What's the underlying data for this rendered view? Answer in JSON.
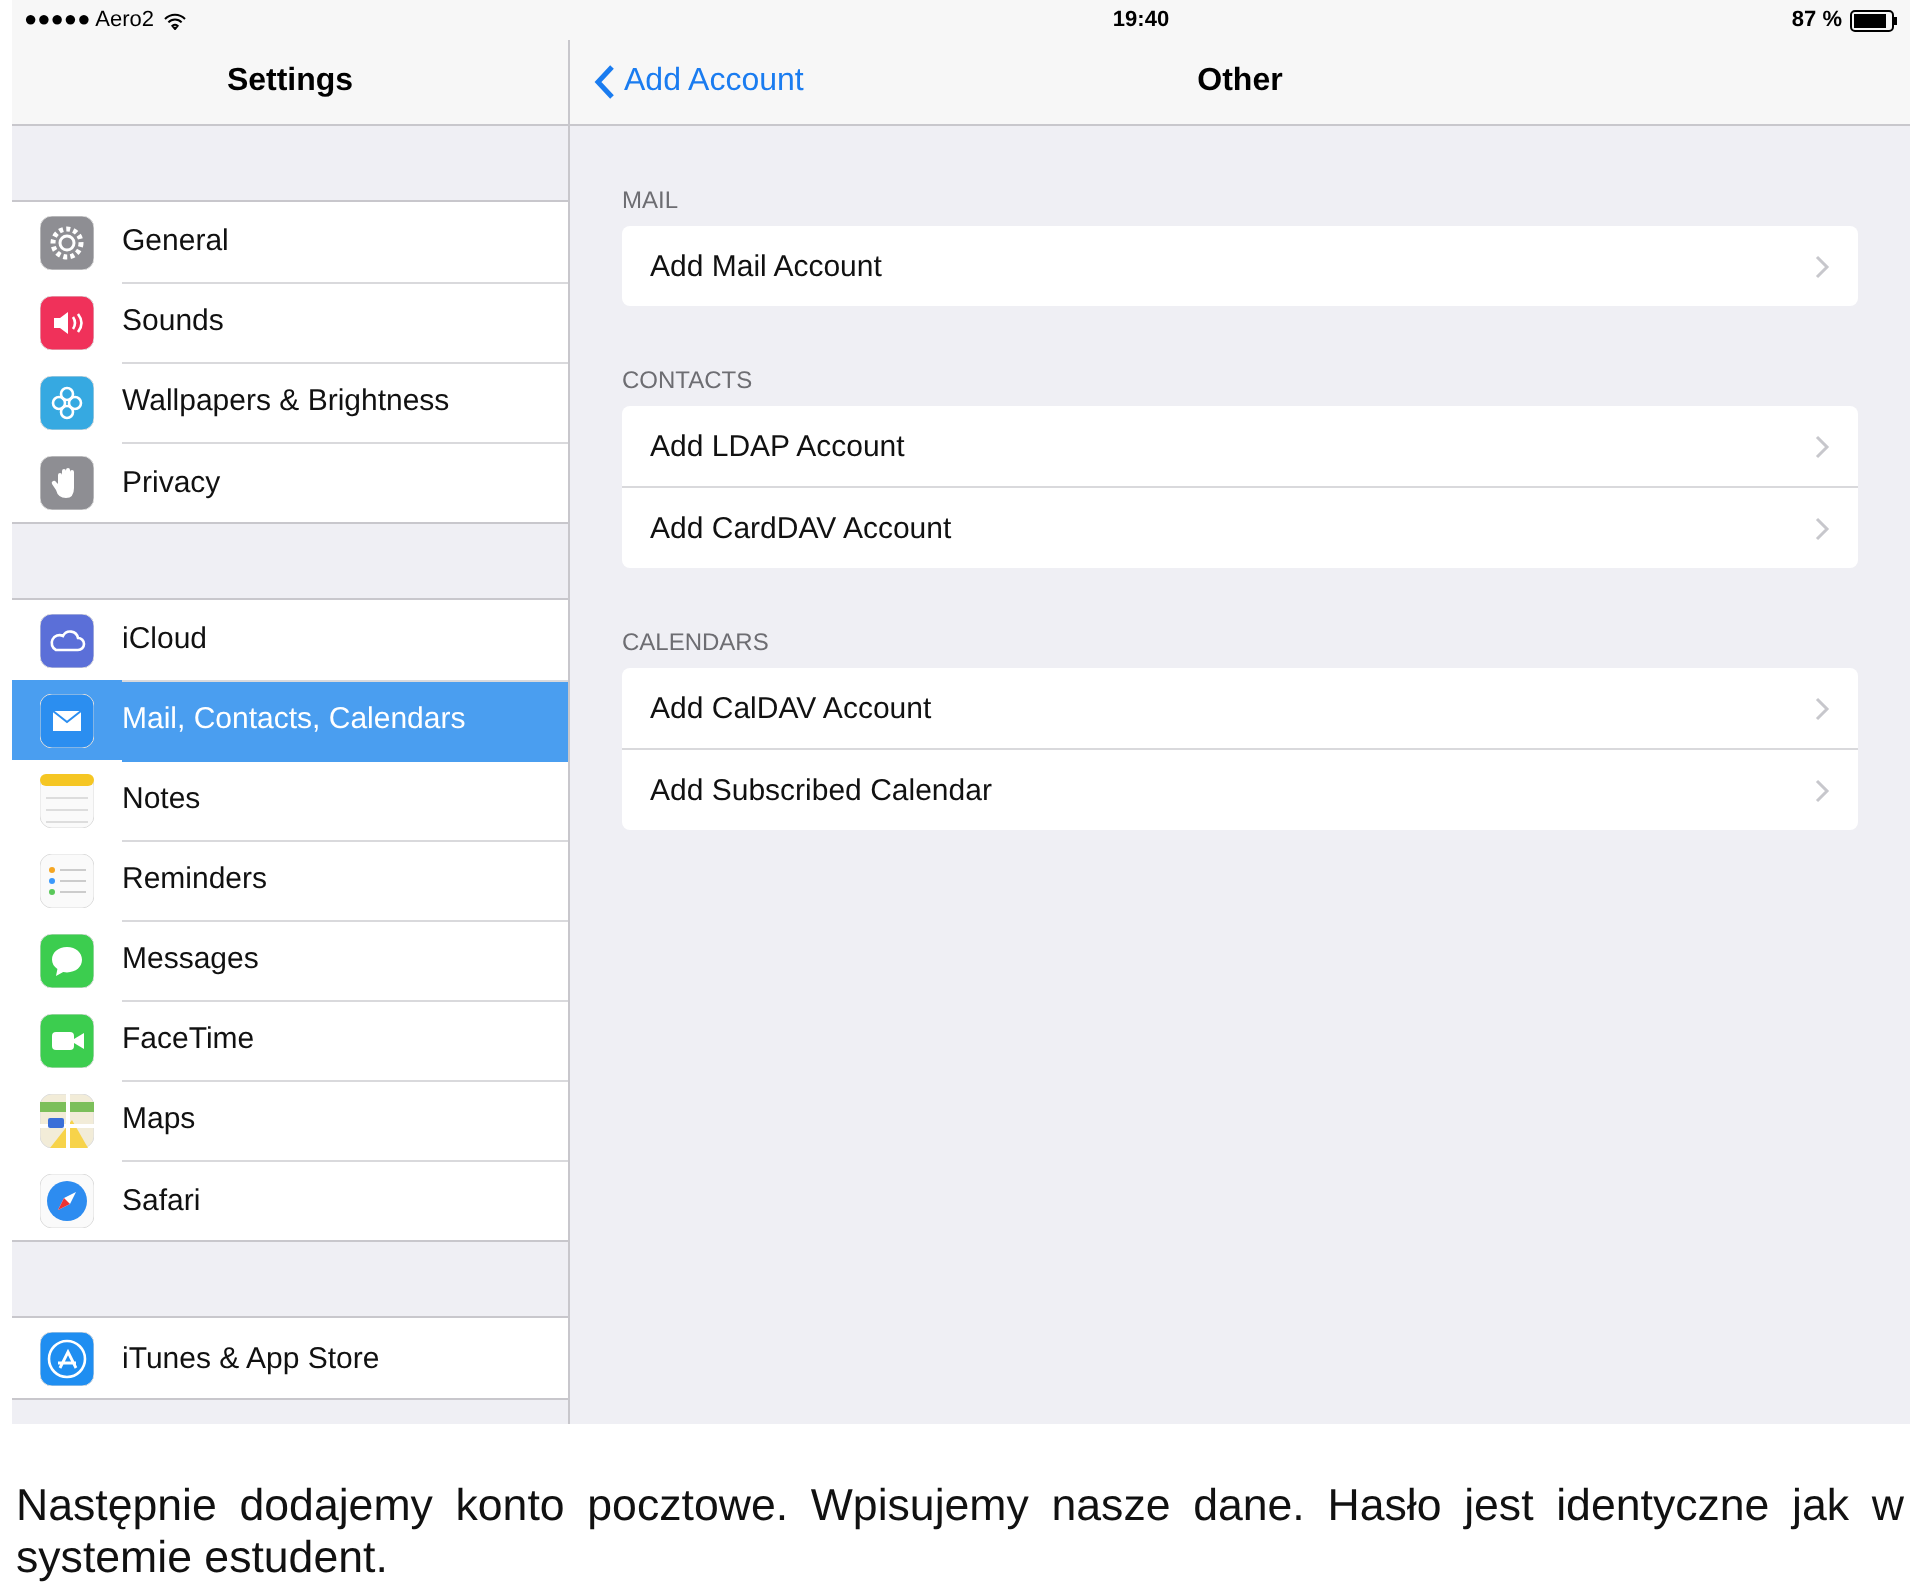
{
  "status_bar": {
    "carrier": "●●●●● Aero2",
    "time": "19:40",
    "battery": "87 %"
  },
  "sidebar": {
    "title": "Settings",
    "groups": [
      [
        {
          "label": "General",
          "selected": false
        },
        {
          "label": "Sounds",
          "selected": false
        },
        {
          "label": "Wallpapers & Brightness",
          "selected": false
        },
        {
          "label": "Privacy",
          "selected": false
        }
      ],
      [
        {
          "label": "iCloud",
          "selected": false
        },
        {
          "label": "Mail, Contacts, Calendars",
          "selected": true
        },
        {
          "label": "Notes",
          "selected": false
        },
        {
          "label": "Reminders",
          "selected": false
        },
        {
          "label": "Messages",
          "selected": false
        },
        {
          "label": "FaceTime",
          "selected": false
        },
        {
          "label": "Maps",
          "selected": false
        },
        {
          "label": "Safari",
          "selected": false
        }
      ],
      [
        {
          "label": "iTunes & App Store",
          "selected": false
        }
      ]
    ]
  },
  "detail": {
    "back": "Add Account",
    "title": "Other",
    "sections": [
      {
        "header": "MAIL",
        "rows": [
          "Add Mail Account"
        ]
      },
      {
        "header": "CONTACTS",
        "rows": [
          "Add LDAP Account",
          "Add CardDAV Account"
        ]
      },
      {
        "header": "CALENDARS",
        "rows": [
          "Add CalDAV Account",
          "Add Subscribed Calendar"
        ]
      }
    ]
  },
  "caption": "Następnie dodajemy konto pocztowe. Wpisujemy nasze dane. Hasło jest identyczne jak w systemie estudent."
}
